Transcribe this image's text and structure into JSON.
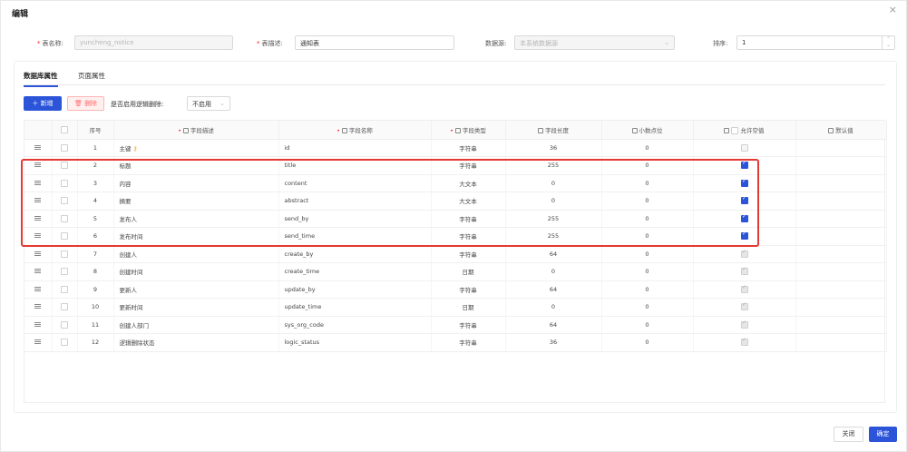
{
  "modal": {
    "title": "编辑",
    "close_icon": "close-icon"
  },
  "form": {
    "table_name_label": "表名称:",
    "table_name_value": "yuncheng_notice",
    "table_desc_label": "表描述:",
    "table_desc_value": "通知表",
    "datasource_label": "数据源:",
    "datasource_value": "本系统数据源",
    "sort_label": "排序:",
    "sort_value": "1"
  },
  "tabs": [
    {
      "label": "数据库属性",
      "active": true
    },
    {
      "label": "页面属性",
      "active": false
    }
  ],
  "toolbar": {
    "add_label": "＋ 新增",
    "delete_label": "删除",
    "logic_delete_label": "是否启用逻辑删除:",
    "logic_delete_value": "不启用"
  },
  "columns": {
    "seq": "序号",
    "desc": "字段描述",
    "name": "字段名称",
    "type": "字段类型",
    "length": "字段长度",
    "decimal": "小数点位",
    "nullable": "允许空值",
    "default": "默认值"
  },
  "rows": [
    {
      "seq": "1",
      "desc": "主键",
      "name": "id",
      "type": "字符串",
      "length": "36",
      "decimal": "0",
      "nullable": "off-disabled",
      "key": true
    },
    {
      "seq": "2",
      "desc": "标题",
      "name": "title",
      "type": "字符串",
      "length": "255",
      "decimal": "0",
      "nullable": "on"
    },
    {
      "seq": "3",
      "desc": "内容",
      "name": "content",
      "type": "大文本",
      "length": "0",
      "decimal": "0",
      "nullable": "on"
    },
    {
      "seq": "4",
      "desc": "摘要",
      "name": "abstract",
      "type": "大文本",
      "length": "0",
      "decimal": "0",
      "nullable": "on"
    },
    {
      "seq": "5",
      "desc": "发布人",
      "name": "send_by",
      "type": "字符串",
      "length": "255",
      "decimal": "0",
      "nullable": "on"
    },
    {
      "seq": "6",
      "desc": "发布时间",
      "name": "send_time",
      "type": "字符串",
      "length": "255",
      "decimal": "0",
      "nullable": "on"
    },
    {
      "seq": "7",
      "desc": "创建人",
      "name": "create_by",
      "type": "字符串",
      "length": "64",
      "decimal": "0",
      "nullable": "on-disabled"
    },
    {
      "seq": "8",
      "desc": "创建时间",
      "name": "create_time",
      "type": "日期",
      "length": "0",
      "decimal": "0",
      "nullable": "on-disabled"
    },
    {
      "seq": "9",
      "desc": "更新人",
      "name": "update_by",
      "type": "字符串",
      "length": "64",
      "decimal": "0",
      "nullable": "on-disabled"
    },
    {
      "seq": "10",
      "desc": "更新时间",
      "name": "update_time",
      "type": "日期",
      "length": "0",
      "decimal": "0",
      "nullable": "on-disabled"
    },
    {
      "seq": "11",
      "desc": "创建人部门",
      "name": "sys_org_code",
      "type": "字符串",
      "length": "64",
      "decimal": "0",
      "nullable": "on-disabled"
    },
    {
      "seq": "12",
      "desc": "逻辑删除状态",
      "name": "logic_status",
      "type": "字符串",
      "length": "36",
      "decimal": "0",
      "nullable": "on-disabled"
    }
  ],
  "footer": {
    "cancel_label": "关闭",
    "ok_label": "确定"
  },
  "colors": {
    "primary": "#2b54d9",
    "highlight_box": "#e53935",
    "required": "#f5222d"
  }
}
